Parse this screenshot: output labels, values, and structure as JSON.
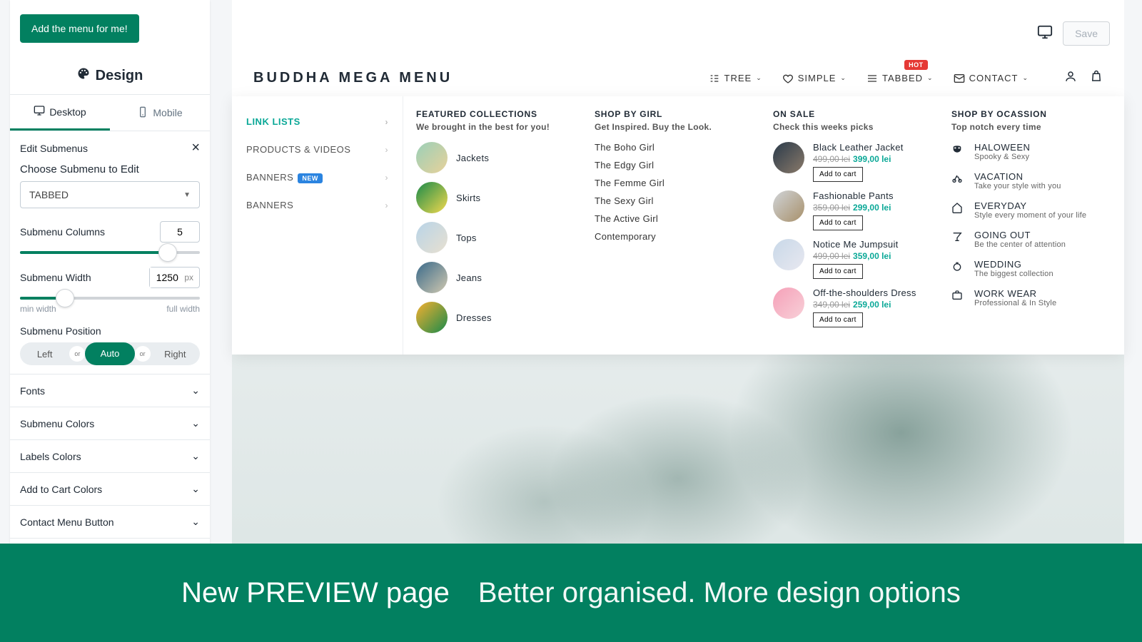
{
  "sidebar": {
    "add_menu_label": "Add the menu for me!",
    "design_label": "Design",
    "tabs": {
      "desktop": "Desktop",
      "mobile": "Mobile"
    },
    "edit_header": "Edit Submenus",
    "choose_label": "Choose Submenu to Edit",
    "select_value": "TABBED",
    "columns_label": "Submenu Columns",
    "columns_value": "5",
    "width_label": "Submenu Width",
    "width_value": "1250",
    "width_unit": "px",
    "width_min_label": "min width",
    "width_max_label": "full width",
    "position_label": "Submenu Position",
    "position_left": "Left",
    "position_auto": "Auto",
    "position_right": "Right",
    "position_or": "or",
    "acc": [
      "Fonts",
      "Submenu Colors",
      "Labels Colors",
      "Add to Cart Colors",
      "Contact Menu Button"
    ]
  },
  "preview": {
    "save_label": "Save",
    "brand": "BUDDHA MEGA MENU",
    "nav": {
      "tree": "TREE",
      "simple": "SIMPLE",
      "tabbed": "TABBED",
      "contact": "CONTACT",
      "hot_badge": "HOT"
    }
  },
  "mega": {
    "tabs": [
      {
        "label": "LINK LISTS",
        "active": true
      },
      {
        "label": "PRODUCTS & VIDEOS"
      },
      {
        "label": "BANNERS",
        "pill": "NEW"
      },
      {
        "label": "BANNERS"
      }
    ],
    "col1": {
      "title": "FEATURED COLLECTIONS",
      "sub": "We brought in the best for you!",
      "items": [
        "Jackets",
        "Skirts",
        "Tops",
        "Jeans",
        "Dresses"
      ]
    },
    "col2": {
      "title": "SHOP BY GIRL",
      "sub": "Get Inspired. Buy the Look.",
      "items": [
        "The Boho Girl",
        "The Edgy Girl",
        "The Femme Girl",
        "The Sexy Girl",
        "The Active Girl",
        "Contemporary"
      ]
    },
    "col3": {
      "title": "ON SALE",
      "sub": "Check this weeks picks",
      "atc_label": "Add to cart",
      "items": [
        {
          "name": "Black Leather Jacket",
          "old": "499,00 lei",
          "new": "399,00 lei"
        },
        {
          "name": "Fashionable Pants",
          "old": "359,00 lei",
          "new": "299,00 lei"
        },
        {
          "name": "Notice Me Jumpsuit",
          "old": "499,00 lei",
          "new": "359,00 lei"
        },
        {
          "name": "Off-the-shoulders Dress",
          "old": "349,00 lei",
          "new": "259,00 lei"
        }
      ]
    },
    "col4": {
      "title": "SHOP BY OCASSION",
      "sub": "Top notch every time",
      "items": [
        {
          "t": "HALOWEEN",
          "s": "Spooky & Sexy"
        },
        {
          "t": "VACATION",
          "s": "Take your style with you"
        },
        {
          "t": "EVERYDAY",
          "s": "Style every moment of your life"
        },
        {
          "t": "GOING OUT",
          "s": "Be the center of attention"
        },
        {
          "t": "WEDDING",
          "s": "The biggest collection"
        },
        {
          "t": "WORK WEAR",
          "s": "Professional & In Style"
        }
      ]
    }
  },
  "footer": {
    "a": "New PREVIEW page",
    "b": "Better organised. More design options"
  }
}
